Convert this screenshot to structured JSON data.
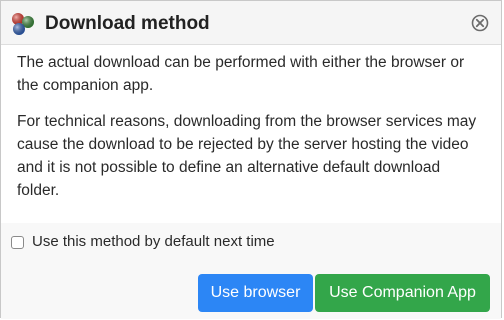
{
  "dialog": {
    "title": "Download method",
    "paragraphs": [
      "The actual download can be performed with either the browser or the companion app.",
      "For technical reasons, downloading from the browser services may cause the download to be rejected by the server hosting the video and it is not possible to define an alternative default download folder."
    ],
    "checkbox": {
      "label": "Use this method by default next time",
      "checked": false
    },
    "buttons": {
      "browser": "Use browser",
      "companion": "Use Companion App"
    }
  },
  "icons": {
    "logo": "vdh-logo-icon",
    "close": "close-circle-icon"
  },
  "colors": {
    "primary_button": "#2c86f5",
    "success_button": "#33a64a"
  }
}
